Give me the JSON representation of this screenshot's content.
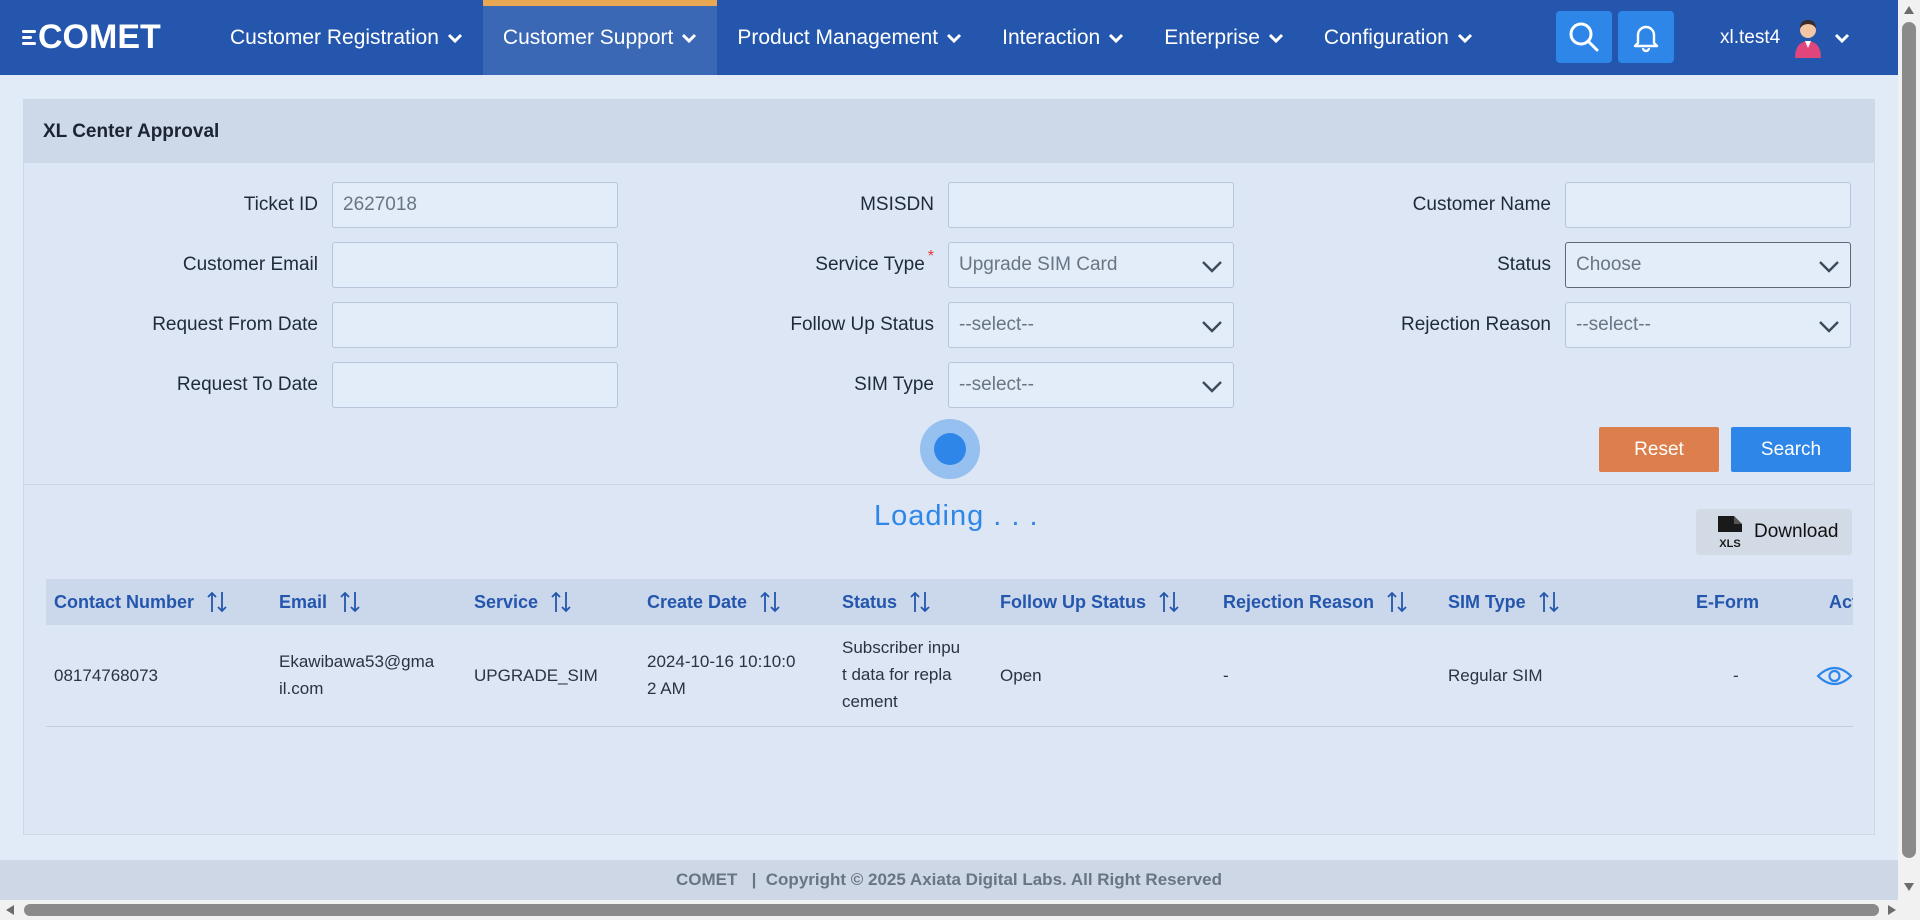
{
  "nav": {
    "logo": "COMET",
    "items": [
      {
        "label": "Customer Registration"
      },
      {
        "label": "Customer Support"
      },
      {
        "label": "Product Management"
      },
      {
        "label": "Interaction"
      },
      {
        "label": "Enterprise"
      },
      {
        "label": "Configuration"
      }
    ],
    "active_item": "Customer Support",
    "username": "xl.test4"
  },
  "panel": {
    "title": "XL Center Approval",
    "labels": {
      "ticket_id": "Ticket ID",
      "msisdn": "MSISDN",
      "customer_name": "Customer Name",
      "customer_email": "Customer Email",
      "service_type": "Service Type",
      "status": "Status",
      "request_from_date": "Request From Date",
      "follow_up_status": "Follow Up Status",
      "rejection_reason": "Rejection Reason",
      "request_to_date": "Request To Date",
      "sim_type": "SIM Type"
    },
    "required_mark": "*",
    "values": {
      "ticket_id": "2627018",
      "msisdn": "",
      "customer_name": "",
      "customer_email": "",
      "service_type": "Upgrade SIM Card",
      "status": "Choose",
      "request_from_date": "",
      "follow_up_status": "--select--",
      "rejection_reason": "--select--",
      "request_to_date": "",
      "sim_type": "--select--"
    },
    "reset_label": "Reset",
    "search_label": "Search",
    "loading_text": "Loading . . .",
    "download_label": "Download",
    "xls_badge": "XLS"
  },
  "table": {
    "columns": [
      "Contact Number",
      "Email",
      "Service",
      "Create Date",
      "Status",
      "Follow Up Status",
      "Rejection Reason",
      "SIM Type",
      "E-Form",
      "Actio"
    ],
    "rows": [
      {
        "contact_number": "08174768073",
        "email_l1": "Ekawibawa53@gma",
        "email_l2": "il.com",
        "service": "UPGRADE_SIM",
        "create_date_l1": "2024-10-16 10:10:0",
        "create_date_l2": "2 AM",
        "status_l1": "Subscriber inpu",
        "status_l2": "t data for repla",
        "status_l3": "cement",
        "follow_up_status": "Open",
        "rejection_reason": "-",
        "sim_type": "Regular SIM",
        "eform": "-"
      }
    ]
  },
  "footer": {
    "text": "COMET   |  Copyright © 2025 Axiata Digital Labs. All Right Reserved"
  },
  "colors": {
    "nav_bg": "#2456ad",
    "accent": "#2e87e8",
    "active_tab_bar": "#e8a752",
    "reset_btn": "#dd7f4c",
    "search_btn": "#2e87e8"
  }
}
